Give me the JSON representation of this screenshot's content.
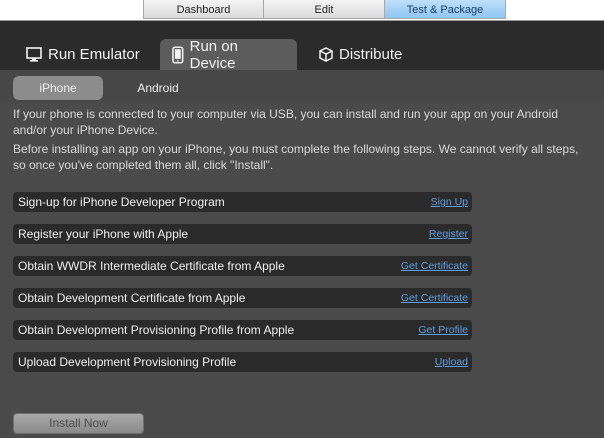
{
  "topnav": {
    "items": [
      "Dashboard",
      "Edit",
      "Test & Package"
    ],
    "active": "Test & Package"
  },
  "maintabs": [
    {
      "label": "Run Emulator",
      "icon": "monitor-icon"
    },
    {
      "label": "Run on Device",
      "icon": "phone-icon"
    },
    {
      "label": "Distribute",
      "icon": "cube-icon"
    }
  ],
  "subtabs": [
    "iPhone",
    "Android"
  ],
  "intro": "If your phone is connected to your computer via USB, you can install and run your app on your Android and/or your iPhone Device.",
  "instructions": "Before installing an app on your iPhone, you must complete the following steps. We cannot verify all steps, so once you've completed them all, click \"Install\".",
  "steps": [
    {
      "label": "Sign-up for iPhone Developer Program",
      "link": "Sign Up"
    },
    {
      "label": "Register your iPhone with Apple",
      "link": "Register"
    },
    {
      "label": "Obtain WWDR Intermediate Certificate from Apple",
      "link": "Get Certificate"
    },
    {
      "label": "Obtain Development Certificate from Apple",
      "link": "Get Certificate"
    },
    {
      "label": "Obtain Development Provisioning Profile from Apple",
      "link": "Get Profile"
    },
    {
      "label": "Upload Development Provisioning Profile",
      "link": "Upload"
    }
  ],
  "install_button": "Install Now",
  "colors": {
    "active_topnav": "#9fcdf5",
    "link": "#5f9fe0",
    "panel": "#4a4a4a"
  }
}
